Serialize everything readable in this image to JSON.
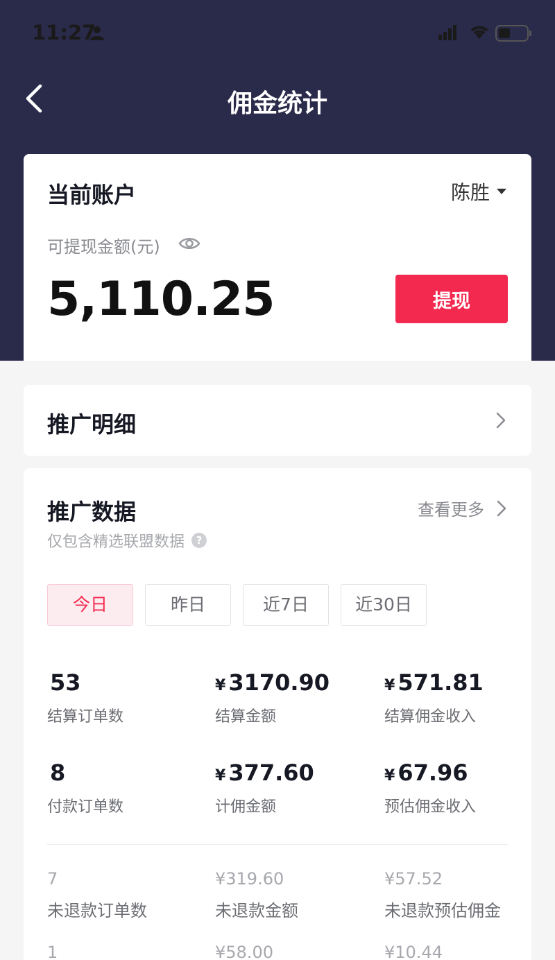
{
  "status_bar": {
    "time": "11:27"
  },
  "nav": {
    "title": "佣金统计"
  },
  "account": {
    "label": "当前账户",
    "name": "陈胜",
    "balance_label": "可提现金额(元)",
    "balance": "5,110.25",
    "withdraw_label": "提现"
  },
  "detail": {
    "label": "推广明细"
  },
  "promo": {
    "title": "推广数据",
    "more_label": "查看更多",
    "note": "仅包含精选联盟数据",
    "tabs": [
      {
        "label": "今日",
        "active": true
      },
      {
        "label": "昨日",
        "active": false
      },
      {
        "label": "近7日",
        "active": false
      },
      {
        "label": "近30日",
        "active": false
      }
    ],
    "stats": [
      {
        "value": "53",
        "currency": "",
        "caption": "结算订单数"
      },
      {
        "value": "3170.90",
        "currency": "¥",
        "caption": "结算金额"
      },
      {
        "value": "571.81",
        "currency": "¥",
        "caption": "结算佣金收入"
      },
      {
        "value": "8",
        "currency": "",
        "caption": "付款订单数"
      },
      {
        "value": "377.60",
        "currency": "¥",
        "caption": "计佣金额"
      },
      {
        "value": "67.96",
        "currency": "¥",
        "caption": "预估佣金收入"
      }
    ],
    "secondary": [
      {
        "value": "7",
        "caption": "未退款订单数"
      },
      {
        "value": "¥319.60",
        "caption": "未退款金额"
      },
      {
        "value": "¥57.52",
        "caption": "未退款预估佣金"
      },
      {
        "value": "1",
        "caption": ""
      },
      {
        "value": "¥58.00",
        "caption": ""
      },
      {
        "value": "¥10.44",
        "caption": ""
      }
    ]
  }
}
